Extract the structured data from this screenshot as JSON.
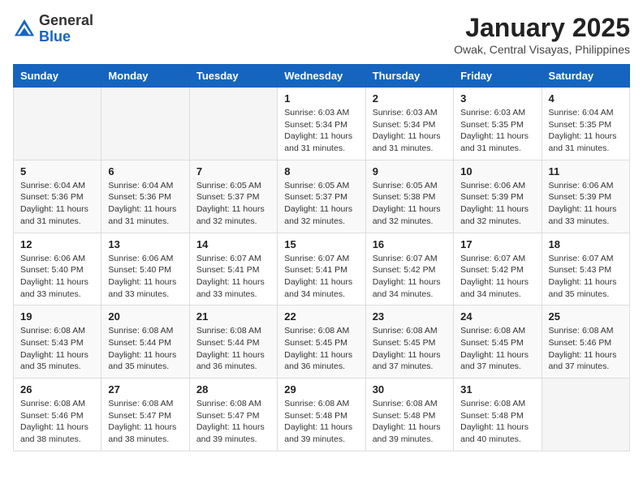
{
  "logo": {
    "general": "General",
    "blue": "Blue"
  },
  "title": "January 2025",
  "subtitle": "Owak, Central Visayas, Philippines",
  "days_of_week": [
    "Sunday",
    "Monday",
    "Tuesday",
    "Wednesday",
    "Thursday",
    "Friday",
    "Saturday"
  ],
  "weeks": [
    [
      {
        "day": "",
        "info": ""
      },
      {
        "day": "",
        "info": ""
      },
      {
        "day": "",
        "info": ""
      },
      {
        "day": "1",
        "sunrise": "6:03 AM",
        "sunset": "5:34 PM",
        "daylight": "11 hours and 31 minutes."
      },
      {
        "day": "2",
        "sunrise": "6:03 AM",
        "sunset": "5:34 PM",
        "daylight": "11 hours and 31 minutes."
      },
      {
        "day": "3",
        "sunrise": "6:03 AM",
        "sunset": "5:35 PM",
        "daylight": "11 hours and 31 minutes."
      },
      {
        "day": "4",
        "sunrise": "6:04 AM",
        "sunset": "5:35 PM",
        "daylight": "11 hours and 31 minutes."
      }
    ],
    [
      {
        "day": "5",
        "sunrise": "6:04 AM",
        "sunset": "5:36 PM",
        "daylight": "11 hours and 31 minutes."
      },
      {
        "day": "6",
        "sunrise": "6:04 AM",
        "sunset": "5:36 PM",
        "daylight": "11 hours and 31 minutes."
      },
      {
        "day": "7",
        "sunrise": "6:05 AM",
        "sunset": "5:37 PM",
        "daylight": "11 hours and 32 minutes."
      },
      {
        "day": "8",
        "sunrise": "6:05 AM",
        "sunset": "5:37 PM",
        "daylight": "11 hours and 32 minutes."
      },
      {
        "day": "9",
        "sunrise": "6:05 AM",
        "sunset": "5:38 PM",
        "daylight": "11 hours and 32 minutes."
      },
      {
        "day": "10",
        "sunrise": "6:06 AM",
        "sunset": "5:39 PM",
        "daylight": "11 hours and 32 minutes."
      },
      {
        "day": "11",
        "sunrise": "6:06 AM",
        "sunset": "5:39 PM",
        "daylight": "11 hours and 33 minutes."
      }
    ],
    [
      {
        "day": "12",
        "sunrise": "6:06 AM",
        "sunset": "5:40 PM",
        "daylight": "11 hours and 33 minutes."
      },
      {
        "day": "13",
        "sunrise": "6:06 AM",
        "sunset": "5:40 PM",
        "daylight": "11 hours and 33 minutes."
      },
      {
        "day": "14",
        "sunrise": "6:07 AM",
        "sunset": "5:41 PM",
        "daylight": "11 hours and 33 minutes."
      },
      {
        "day": "15",
        "sunrise": "6:07 AM",
        "sunset": "5:41 PM",
        "daylight": "11 hours and 34 minutes."
      },
      {
        "day": "16",
        "sunrise": "6:07 AM",
        "sunset": "5:42 PM",
        "daylight": "11 hours and 34 minutes."
      },
      {
        "day": "17",
        "sunrise": "6:07 AM",
        "sunset": "5:42 PM",
        "daylight": "11 hours and 34 minutes."
      },
      {
        "day": "18",
        "sunrise": "6:07 AM",
        "sunset": "5:43 PM",
        "daylight": "11 hours and 35 minutes."
      }
    ],
    [
      {
        "day": "19",
        "sunrise": "6:08 AM",
        "sunset": "5:43 PM",
        "daylight": "11 hours and 35 minutes."
      },
      {
        "day": "20",
        "sunrise": "6:08 AM",
        "sunset": "5:44 PM",
        "daylight": "11 hours and 35 minutes."
      },
      {
        "day": "21",
        "sunrise": "6:08 AM",
        "sunset": "5:44 PM",
        "daylight": "11 hours and 36 minutes."
      },
      {
        "day": "22",
        "sunrise": "6:08 AM",
        "sunset": "5:45 PM",
        "daylight": "11 hours and 36 minutes."
      },
      {
        "day": "23",
        "sunrise": "6:08 AM",
        "sunset": "5:45 PM",
        "daylight": "11 hours and 37 minutes."
      },
      {
        "day": "24",
        "sunrise": "6:08 AM",
        "sunset": "5:45 PM",
        "daylight": "11 hours and 37 minutes."
      },
      {
        "day": "25",
        "sunrise": "6:08 AM",
        "sunset": "5:46 PM",
        "daylight": "11 hours and 37 minutes."
      }
    ],
    [
      {
        "day": "26",
        "sunrise": "6:08 AM",
        "sunset": "5:46 PM",
        "daylight": "11 hours and 38 minutes."
      },
      {
        "day": "27",
        "sunrise": "6:08 AM",
        "sunset": "5:47 PM",
        "daylight": "11 hours and 38 minutes."
      },
      {
        "day": "28",
        "sunrise": "6:08 AM",
        "sunset": "5:47 PM",
        "daylight": "11 hours and 39 minutes."
      },
      {
        "day": "29",
        "sunrise": "6:08 AM",
        "sunset": "5:48 PM",
        "daylight": "11 hours and 39 minutes."
      },
      {
        "day": "30",
        "sunrise": "6:08 AM",
        "sunset": "5:48 PM",
        "daylight": "11 hours and 39 minutes."
      },
      {
        "day": "31",
        "sunrise": "6:08 AM",
        "sunset": "5:48 PM",
        "daylight": "11 hours and 40 minutes."
      },
      {
        "day": "",
        "info": ""
      }
    ]
  ]
}
